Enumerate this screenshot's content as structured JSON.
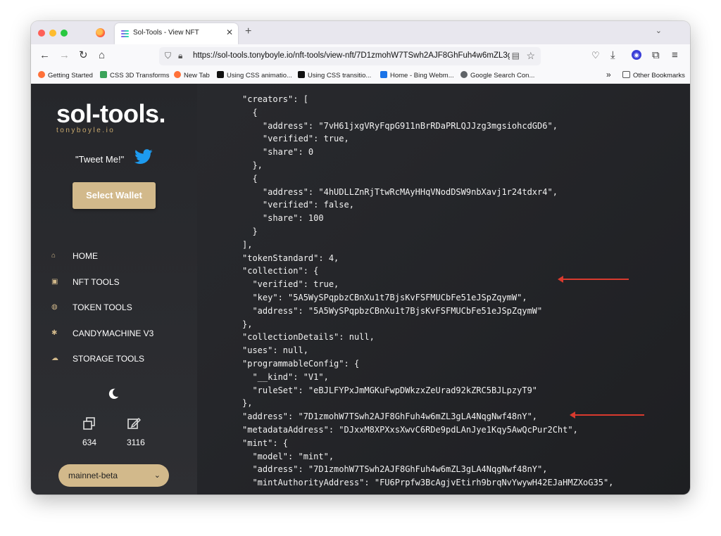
{
  "browser": {
    "tab_title": "Sol-Tools - View NFT",
    "url": "https://sol-tools.tonyboyle.io/nft-tools/view-nft/7D1zmohW7TSwh2AJF8GhFuh4w6mZL3g",
    "bookmarks": [
      {
        "label": "Getting Started",
        "icon": "firefox-icon",
        "color": "#ff7139"
      },
      {
        "label": "CSS 3D Transforms",
        "icon": "w-icon",
        "color": "#3aa35a"
      },
      {
        "label": "New Tab",
        "icon": "firefox-icon",
        "color": "#ff7139"
      },
      {
        "label": "Using CSS animatio...",
        "icon": "mdn-icon",
        "color": "#111111"
      },
      {
        "label": "Using CSS transitio...",
        "icon": "mdn-icon",
        "color": "#111111"
      },
      {
        "label": "Home - Bing Webm...",
        "icon": "bing-icon",
        "color": "#1a73e8"
      },
      {
        "label": "Google Search Con...",
        "icon": "google-search-console-icon",
        "color": "#5f6368"
      }
    ],
    "other_bookmarks": "Other Bookmarks"
  },
  "sidebar": {
    "logo": "sol-tools.",
    "logo_sub": "tonyboyle.io",
    "tweet": "\"Tweet Me!\"",
    "select_wallet": "Select Wallet",
    "nav": [
      {
        "label": "HOME",
        "icon": "home-icon"
      },
      {
        "label": "NFT TOOLS",
        "icon": "image-icon"
      },
      {
        "label": "TOKEN TOOLS",
        "icon": "coins-icon"
      },
      {
        "label": "CANDYMACHINE V3",
        "icon": "candy-icon"
      },
      {
        "label": "STORAGE TOOLS",
        "icon": "cloud-upload-icon"
      }
    ],
    "stats": [
      {
        "value": "634",
        "icon": "copy-icon"
      },
      {
        "value": "3116",
        "icon": "edit-icon"
      }
    ],
    "network": "mainnet-beta"
  },
  "code_lines": [
    "\"creators\": [",
    "  {",
    "    \"address\": \"7vH61jxgVRyFqpG911nBrRDaPRLQJJzg3mgsiohcdGD6\",",
    "    \"verified\": true,",
    "    \"share\": 0",
    "  },",
    "  {",
    "    \"address\": \"4hUDLLZnRjTtwRcMAyHHqVNodDSW9nbXavj1r24tdxr4\",",
    "    \"verified\": false,",
    "    \"share\": 100",
    "  }",
    "],",
    "\"tokenStandard\": 4,",
    "\"collection\": {",
    "  \"verified\": true,",
    "  \"key\": \"5A5WySPqpbzCBnXu1t7BjsKvFSFMUCbFe51eJSpZqymW\",",
    "  \"address\": \"5A5WySPqpbzCBnXu1t7BjsKvFSFMUCbFe51eJSpZqymW\"",
    "},",
    "\"collectionDetails\": null,",
    "\"uses\": null,",
    "\"programmableConfig\": {",
    "  \"__kind\": \"V1\",",
    "  \"ruleSet\": \"eBJLFYPxJmMGKuFwpDWkzxZeUrad92kZRC5BJLpzyT9\"",
    "},",
    "\"address\": \"7D1zmohW7TSwh2AJF8GhFuh4w6mZL3gLA4NqgNwf48nY\",",
    "\"metadataAddress\": \"DJxxM8XPXxsXwvC6RDe9pdLAnJye1Kqy5AwQcPur2Cht\",",
    "\"mint\": {",
    "  \"model\": \"mint\",",
    "  \"address\": \"7D1zmohW7TSwh2AJF8GhFuh4w6mZL3gLA4NqgNwf48nY\",",
    "  \"mintAuthorityAddress\": \"FU6Prpfw3BcAgjvEtirh9brqNvYwywH42EJaHMZXoG35\","
  ],
  "annotation_color": "#d93a2e",
  "accent_color": "#d2b98b"
}
